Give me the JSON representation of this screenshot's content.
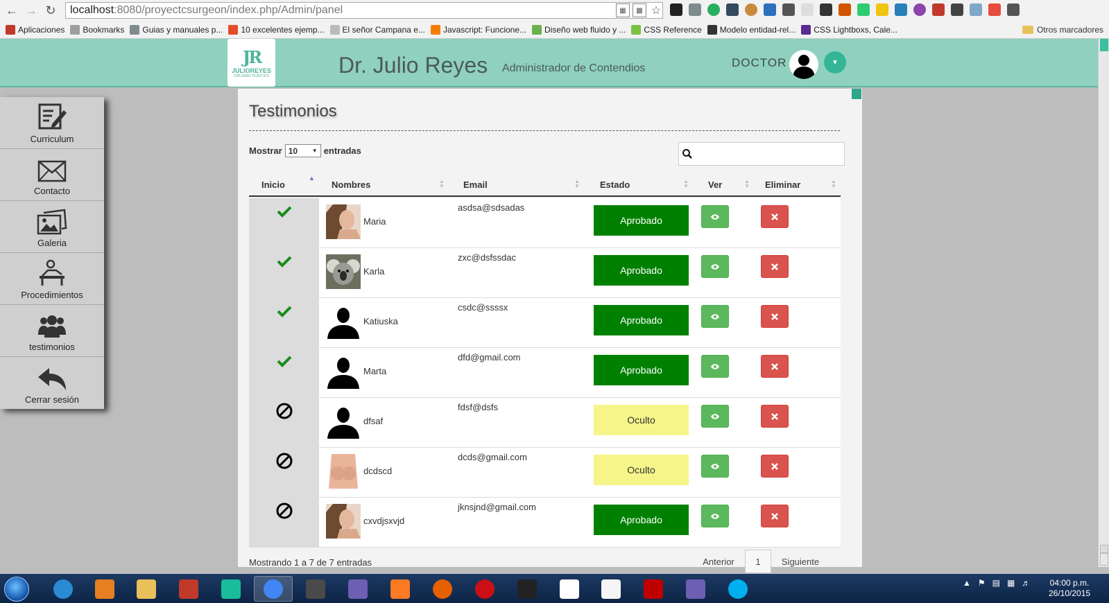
{
  "browser": {
    "url_host": "localhost",
    "url_path": ":8080/proyectcsurgeon/index.php/Admin/panel",
    "bookmarks": [
      {
        "label": "Aplicaciones",
        "color": "#c0392b"
      },
      {
        "label": "Bookmarks",
        "color": "#9e9e9e"
      },
      {
        "label": "Guias y manuales p...",
        "color": "#7f8c8d"
      },
      {
        "label": "10 excelentes ejemp...",
        "color": "#e34c26"
      },
      {
        "label": "El señor Campana e...",
        "color": "#bbbbbb"
      },
      {
        "label": "Javascript: Funcione...",
        "color": "#f57d00"
      },
      {
        "label": "Diseño web fluido y ...",
        "color": "#6ab04c"
      },
      {
        "label": "CSS Reference",
        "color": "#7bc142"
      },
      {
        "label": "Modelo entidad-rel...",
        "color": "#333333"
      },
      {
        "label": "CSS Lightboxs, Cale...",
        "color": "#5b2c8f"
      }
    ],
    "other_bookmarks": "Otros marcadores"
  },
  "header": {
    "logo_mark": "JR",
    "logo_name": "JULIOREYES",
    "logo_sub": "CIRUJANO PLÁSTICO",
    "title": "Dr. Julio Reyes",
    "subtitle": "Administrador de Contendios",
    "user_label": "DOCTOR"
  },
  "sidebar": {
    "items": [
      {
        "label": "Curriculum",
        "icon": "edit-document-icon"
      },
      {
        "label": "Contacto",
        "icon": "envelope-icon"
      },
      {
        "label": "Galeria",
        "icon": "picture-icon"
      },
      {
        "label": "Procedimientos",
        "icon": "procedure-icon"
      },
      {
        "label": "testimonios",
        "icon": "users-icon"
      },
      {
        "label": "Cerrar sesión",
        "icon": "reply-arrow-icon"
      }
    ]
  },
  "main": {
    "page_title": "Testimonios",
    "length_prefix": "Mostrar",
    "length_value": "10",
    "length_suffix": "entradas",
    "search_value": "",
    "columns": [
      "Inicio",
      "Nombres",
      "Email",
      "Estado",
      "Ver",
      "Eliminar"
    ],
    "rows": [
      {
        "inicio": "check",
        "nombre": "Maria",
        "email": "asdsa@sdsadas",
        "estado": "Aprobado",
        "photo": "woman"
      },
      {
        "inicio": "check",
        "nombre": "Karla",
        "email": "zxc@dsfssdac",
        "estado": "Aprobado",
        "photo": "koala"
      },
      {
        "inicio": "check",
        "nombre": "Katiuska",
        "email": "csdc@ssssx",
        "estado": "Aprobado",
        "photo": "silhouette"
      },
      {
        "inicio": "check",
        "nombre": "Marta",
        "email": "dfd@gmail.com",
        "estado": "Aprobado",
        "photo": "silhouette"
      },
      {
        "inicio": "ban",
        "nombre": "dfsaf",
        "email": "fdsf@dsfs",
        "estado": "Oculto",
        "photo": "silhouette"
      },
      {
        "inicio": "ban",
        "nombre": "dcdscd",
        "email": "dcds@gmail.com",
        "estado": "Oculto",
        "photo": "torso"
      },
      {
        "inicio": "ban",
        "nombre": "cxvdjsxvjd",
        "email": "jknsjnd@gmail.com",
        "estado": "Aprobado",
        "photo": "woman"
      }
    ],
    "info": "Mostrando 1 a 7 de 7 entradas",
    "pager": {
      "prev": "Anterior",
      "page": "1",
      "next": "Siguiente"
    }
  },
  "taskbar": {
    "time": "04:00 p.m.",
    "date": "26/10/2015",
    "apps": [
      {
        "name": "internet-explorer",
        "color": "#2a8ad4"
      },
      {
        "name": "media-player",
        "color": "#e67e22"
      },
      {
        "name": "file-explorer",
        "color": "#e8c15a"
      },
      {
        "name": "snipping-tool",
        "color": "#c0392b"
      },
      {
        "name": "paint",
        "color": "#1abc9c"
      },
      {
        "name": "chrome",
        "color": "#4285f4"
      },
      {
        "name": "sublime-text",
        "color": "#4a4a4a"
      },
      {
        "name": "git-gui",
        "color": "#6d5fb3"
      },
      {
        "name": "xampp",
        "color": "#fb7a24"
      },
      {
        "name": "firefox",
        "color": "#e66000"
      },
      {
        "name": "opera",
        "color": "#cc0f16"
      },
      {
        "name": "7zip",
        "color": "#222222"
      },
      {
        "name": "office-grid",
        "color": "#ffffff"
      },
      {
        "name": "notepad",
        "color": "#f5f5f5"
      },
      {
        "name": "filezilla",
        "color": "#bf0000"
      },
      {
        "name": "git-gui-2",
        "color": "#6d5fb3"
      },
      {
        "name": "skype",
        "color": "#00aff0"
      }
    ]
  },
  "colors": {
    "header_bg": "#8fd0bf",
    "accent": "#34b598",
    "approved": "#008000",
    "hidden": "#f5f58a",
    "view_btn": "#5cb85c",
    "delete_btn": "#d9534f"
  }
}
